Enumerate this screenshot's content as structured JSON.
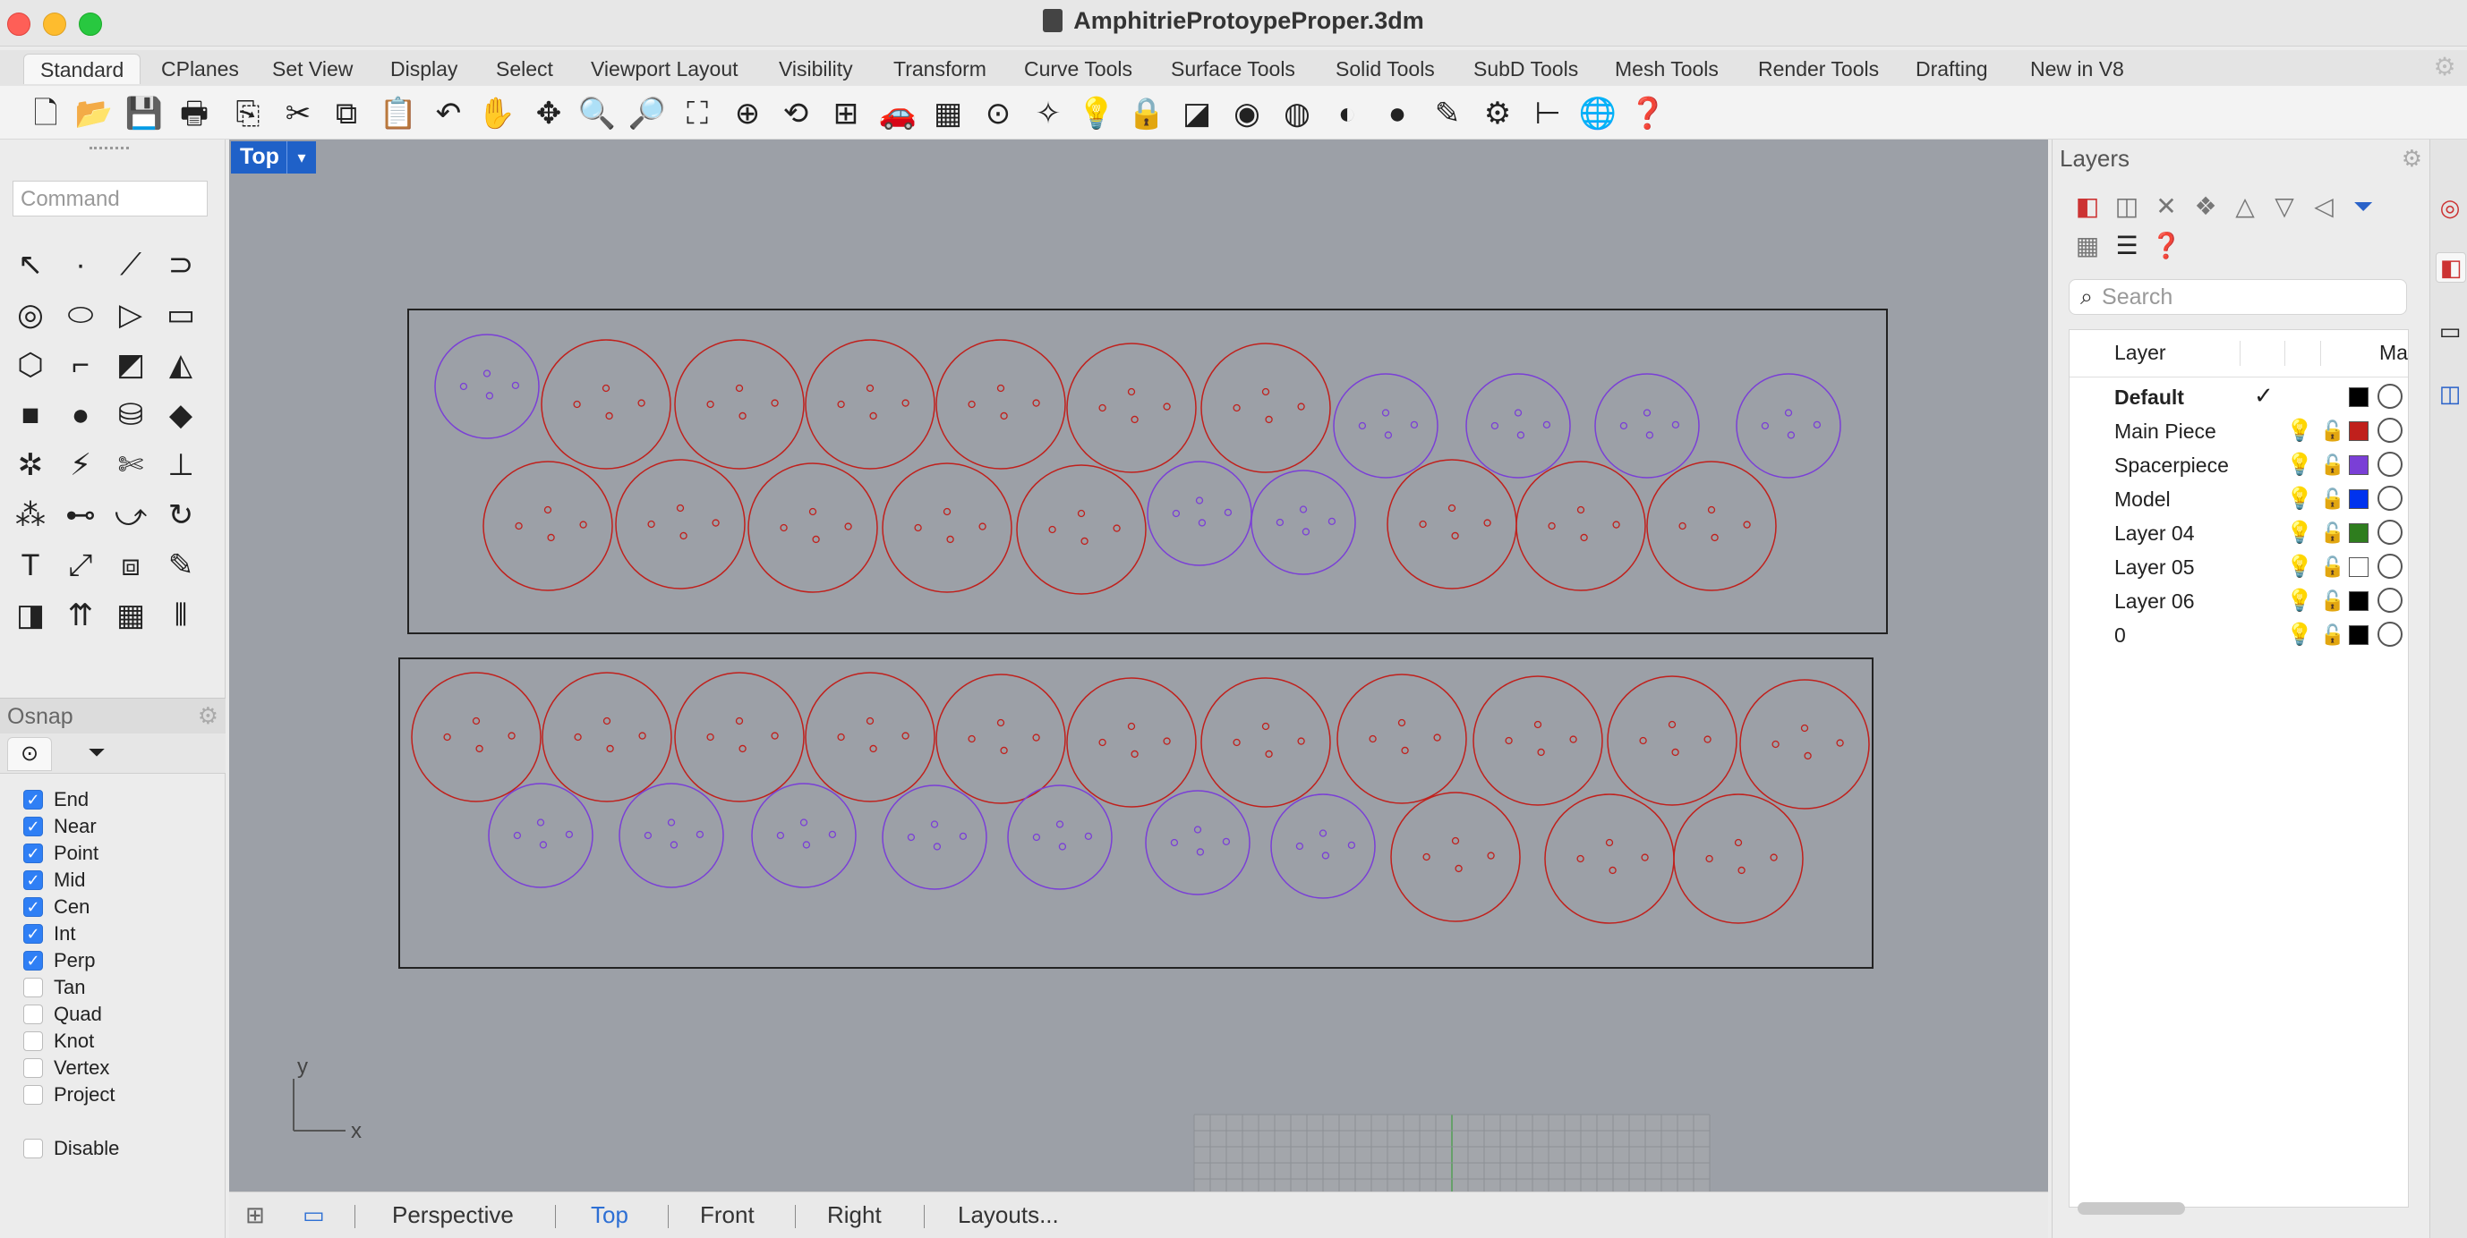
{
  "window": {
    "title": "AmphitrieProtoypeProper.3dm"
  },
  "tabs": [
    "Standard",
    "CPlanes",
    "Set View",
    "Display",
    "Select",
    "Viewport Layout",
    "Visibility",
    "Transform",
    "Curve Tools",
    "Surface Tools",
    "Solid Tools",
    "SubD Tools",
    "Mesh Tools",
    "Render Tools",
    "Drafting",
    "New in V8"
  ],
  "active_tab": "Standard",
  "toolbar_icons": [
    "new-file-icon",
    "open-folder-icon",
    "save-icon",
    "print-icon",
    "import-icon",
    "cut-icon",
    "copy-icon",
    "paste-icon",
    "undo-icon",
    "pan-hand-icon",
    "rotate-view-icon",
    "zoom-icon",
    "zoom-window-icon",
    "zoom-extents-icon",
    "zoom-selected-icon",
    "undo-view-icon",
    "four-viewports-icon",
    "car-named-view-icon",
    "cplane-icon",
    "point-icon",
    "snap-icon",
    "light-icon",
    "lock-icon",
    "properties-icon",
    "color-wheel-icon",
    "wireframe-sphere-icon",
    "shaded-sphere-icon",
    "rendered-sphere-icon",
    "render-icon",
    "settings-gear-icon",
    "dimension-icon",
    "globe-icon",
    "help-icon"
  ],
  "command": {
    "placeholder": "Command"
  },
  "viewport": {
    "name": "Top",
    "axis_y": "y",
    "axis_x": "x"
  },
  "bottom_tabs": [
    "Perspective",
    "Top",
    "Front",
    "Right",
    "Layouts..."
  ],
  "active_view": "Top",
  "osnap": {
    "title": "Osnap",
    "items": [
      {
        "label": "End",
        "checked": true
      },
      {
        "label": "Near",
        "checked": true
      },
      {
        "label": "Point",
        "checked": true
      },
      {
        "label": "Mid",
        "checked": true
      },
      {
        "label": "Cen",
        "checked": true
      },
      {
        "label": "Int",
        "checked": true
      },
      {
        "label": "Perp",
        "checked": true
      },
      {
        "label": "Tan",
        "checked": false
      },
      {
        "label": "Quad",
        "checked": false
      },
      {
        "label": "Knot",
        "checked": false
      },
      {
        "label": "Vertex",
        "checked": false
      },
      {
        "label": "Project",
        "checked": false
      }
    ],
    "disable": {
      "label": "Disable",
      "checked": false
    }
  },
  "layers": {
    "title": "Layers",
    "search_placeholder": "Search",
    "col_layer": "Layer",
    "col_material": "Ma",
    "rows": [
      {
        "name": "Default",
        "current": true,
        "color": "#000000"
      },
      {
        "name": "Main Piece",
        "current": false,
        "color": "#c0201c"
      },
      {
        "name": "Spacerpiece",
        "current": false,
        "color": "#7a3fd6"
      },
      {
        "name": "Model",
        "current": false,
        "color": "#0033ee"
      },
      {
        "name": "Layer 04",
        "current": false,
        "color": "#2e7d1e"
      },
      {
        "name": "Layer 05",
        "current": false,
        "color": "#ffffff"
      },
      {
        "name": "Layer 06",
        "current": false,
        "color": "#000000"
      },
      {
        "name": "0",
        "current": false,
        "color": "#000000"
      }
    ]
  },
  "colors": {
    "main_piece": "#c0201c",
    "spacer_piece": "#7a3fd6",
    "viewport_bg": "#9ca0a7",
    "accent": "#2d6fd4"
  }
}
